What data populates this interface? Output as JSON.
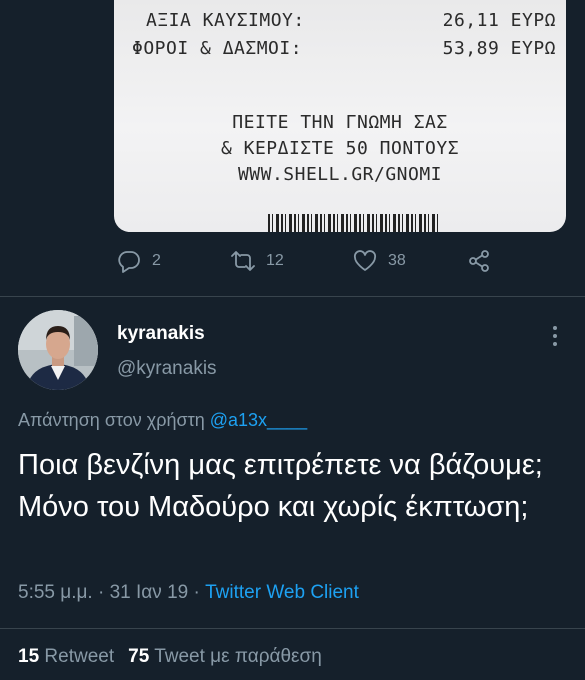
{
  "receipt": {
    "fuel_value_label": "ΑΞΙΑ ΚΑΥΣΙΜΟΥ:",
    "fuel_value_amount": "26,11 ΕΥΡΩ",
    "taxes_label": "ΦΟΡΟΙ & ΔΑΣΜΟΙ:",
    "taxes_amount": "53,89 ΕΥΡΩ",
    "promo_line1": "ΠΕΙΤΕ ΤΗΝ ΓΝΩΜΗ ΣΑΣ",
    "promo_line2": "& ΚΕΡΔΙΣΤΕ 50 ΠΟΝΤΟΥΣ",
    "promo_line3": "WWW.SHELL.GR/GNOMI"
  },
  "parent_actions": {
    "reply_count": "2",
    "retweet_count": "12",
    "like_count": "38"
  },
  "tweet": {
    "display_name": "kyranakis",
    "handle": "@kyranakis",
    "reply_prefix": "Απάντηση στον χρήστη ",
    "reply_mention": "@a13x____",
    "text": "Ποια βενζίνη μας επιτρέπετε να βάζουμε; Μόνο του Μαδούρο και χωρίς έκπτωση;",
    "time": "5:55 μ.μ.",
    "separator": " · ",
    "date": "31 Ιαν 19",
    "separator2": " · ",
    "client": "Twitter Web Client"
  },
  "stats": {
    "retweets_count": "15",
    "retweets_label": " Retweet",
    "quotes_count": "75",
    "quotes_label": " Tweet με παράθεση"
  },
  "colors": {
    "background": "#15202b",
    "secondary_text": "#8899a6",
    "accent": "#1da1f2",
    "divider": "#38444d"
  },
  "icons": [
    "reply-icon",
    "retweet-icon",
    "like-icon",
    "share-icon",
    "more-icon"
  ]
}
